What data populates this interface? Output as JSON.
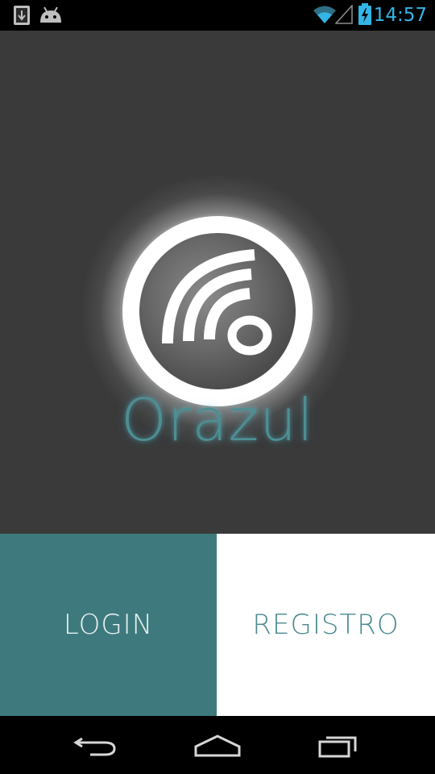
{
  "status_bar": {
    "time": "14:57",
    "left_icons": [
      "download-icon",
      "android-icon"
    ],
    "right_icons": [
      "wifi-icon",
      "cell-signal-icon",
      "battery-charging-icon"
    ],
    "accent_color": "#33b5e5"
  },
  "splash": {
    "app_name": "Orazul",
    "logo_icon": "orazul-logo-icon",
    "background_color": "#3a3a3a",
    "app_name_color": "#4d8e93"
  },
  "actions": {
    "login_label": "LOGIN",
    "registro_label": "REGISTRO",
    "login_color": "#3e7a7d",
    "registro_color": "#ffffff"
  },
  "nav_bar": {
    "icons": [
      "back-icon",
      "home-icon",
      "recent-apps-icon"
    ]
  }
}
